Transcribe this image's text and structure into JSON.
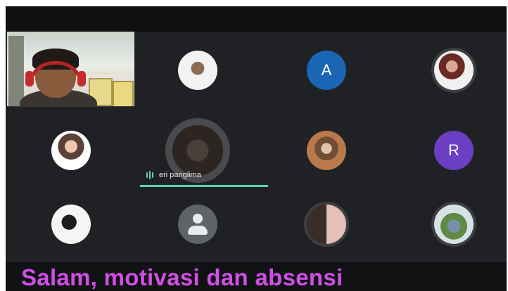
{
  "meeting": {
    "participants": [
      {
        "name": "A",
        "type": "letter",
        "color": "#1a66b5"
      },
      {
        "name": "R",
        "type": "letter",
        "color": "#6b3fc4"
      }
    ],
    "active_speaker": {
      "name": "eri panglima"
    }
  },
  "caption": {
    "text": "Salam, motivasi dan absensi",
    "color": "#d14fe6"
  },
  "icons": {
    "speaking": "speaking-indicator-icon",
    "default_avatar": "person-icon"
  },
  "colors": {
    "background": "#202124",
    "speaking_accent": "#5fd0b8"
  }
}
